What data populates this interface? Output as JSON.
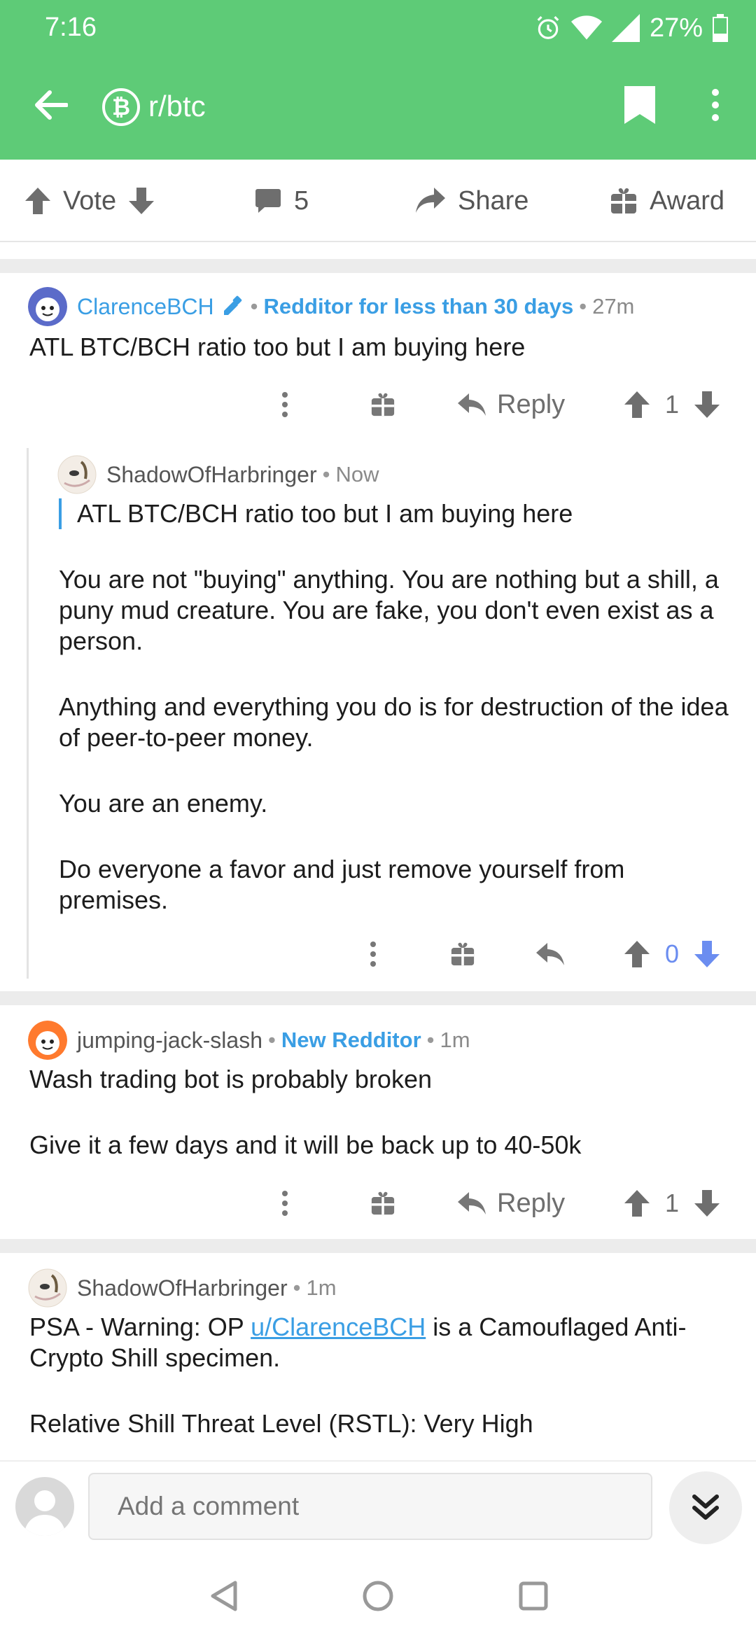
{
  "status_bar": {
    "time": "7:16",
    "battery": "27%"
  },
  "app_bar": {
    "subreddit": "r/btc",
    "subreddit_icon": "bitcoin-icon"
  },
  "post_actions": {
    "vote_label": "Vote",
    "comment_count": "5",
    "share_label": "Share",
    "award_label": "Award"
  },
  "comments": [
    {
      "author": "ClarenceBCH",
      "flair": "Redditor for less than 30 days",
      "time": "27m",
      "body": [
        "ATL BTC/BCH ratio too but I am buying here"
      ],
      "reply_label": "Reply",
      "score": "1"
    },
    {
      "author": "ShadowOfHarbringer",
      "time": "Now",
      "quote": "ATL BTC/BCH ratio too but I am buying here",
      "body": [
        "You are not \"buying\" anything. You are nothing but a shill, a puny mud creature. You are fake, you don't even exist as a person.",
        "Anything and everything you do is for destruction of the idea of peer-to-peer money.",
        "You are an enemy.",
        "Do everyone a favor and just remove yourself from premises."
      ],
      "score": "0"
    },
    {
      "author": "jumping-jack-slash",
      "flair": "New Redditor",
      "time": "1m",
      "body": [
        "Wash trading bot is probably broken",
        "Give it a few days and it will be back up to 40-50k"
      ],
      "reply_label": "Reply",
      "score": "1"
    },
    {
      "author": "ShadowOfHarbringer",
      "time": "1m",
      "body_prefix": "PSA - Warning: OP ",
      "body_link": "u/ClarenceBCH",
      "body_suffix": " is a Camouflaged Anti-Crypto Shill specimen.",
      "body_2": "Relative Shill Threat Level (RSTL): Very High"
    }
  ],
  "composer": {
    "placeholder": "Add a comment"
  },
  "colors": {
    "header": "#5ecb77",
    "accent": "#3a9ee4",
    "downvote_active": "#6b8df0"
  }
}
